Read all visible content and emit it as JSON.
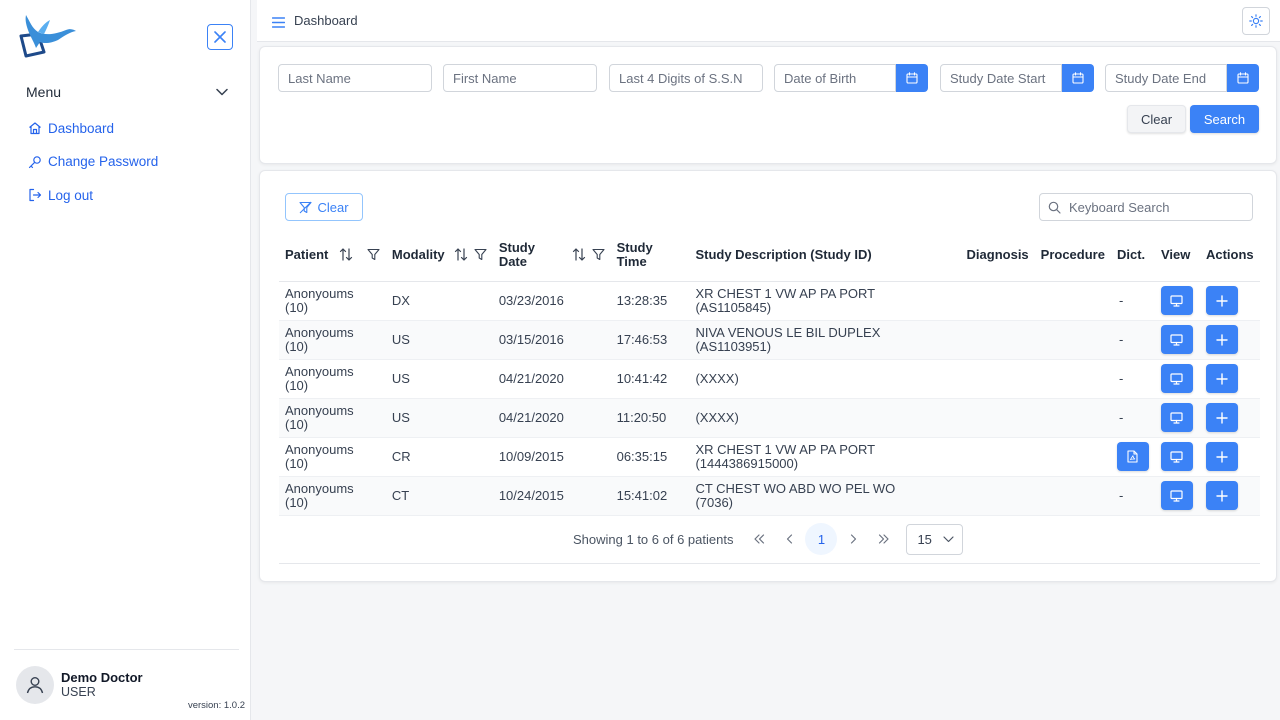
{
  "sidebar": {
    "menu_label": "Menu",
    "items": [
      {
        "label": "Dashboard",
        "icon": "home-icon"
      },
      {
        "label": "Change Password",
        "icon": "key-icon"
      },
      {
        "label": "Log out",
        "icon": "logout-icon"
      }
    ],
    "user": {
      "name": "Demo Doctor",
      "role": "USER"
    },
    "version": "version: 1.0.2"
  },
  "topbar": {
    "title": "Dashboard"
  },
  "search": {
    "last_name_placeholder": "Last Name",
    "first_name_placeholder": "First Name",
    "ssn_placeholder": "Last 4 Digits of S.S.N",
    "dob_placeholder": "Date of Birth",
    "study_start_placeholder": "Study Date Start",
    "study_end_placeholder": "Study Date End",
    "clear_label": "Clear",
    "search_label": "Search"
  },
  "results": {
    "filter_clear_label": "Clear",
    "keyboard_search_placeholder": "Keyboard Search",
    "columns": {
      "patient": "Patient",
      "modality": "Modality",
      "study_date": "Study Date",
      "study_time": "Study Time",
      "description": "Study Description (Study ID)",
      "diagnosis": "Diagnosis",
      "procedure": "Procedure",
      "dict": "Dict.",
      "view": "View",
      "actions": "Actions"
    },
    "rows": [
      {
        "patient": "Anonyoums (10)",
        "modality": "DX",
        "date": "03/23/2016",
        "time": "13:28:35",
        "description": "XR CHEST 1 VW AP PA PORT (AS1105845)",
        "dict": "-"
      },
      {
        "patient": "Anonyoums (10)",
        "modality": "US",
        "date": "03/15/2016",
        "time": "17:46:53",
        "description": "NIVA VENOUS LE BIL DUPLEX (AS1103951)",
        "dict": "-"
      },
      {
        "patient": "Anonyoums (10)",
        "modality": "US",
        "date": "04/21/2020",
        "time": "10:41:42",
        "description": "(XXXX)",
        "dict": "-"
      },
      {
        "patient": "Anonyoums (10)",
        "modality": "US",
        "date": "04/21/2020",
        "time": "11:20:50",
        "description": "(XXXX)",
        "dict": "-"
      },
      {
        "patient": "Anonyoums (10)",
        "modality": "CR",
        "date": "10/09/2015",
        "time": "06:35:15",
        "description": "XR CHEST 1 VW AP PA PORT (1444386915000)",
        "dict": "pdf"
      },
      {
        "patient": "Anonyoums (10)",
        "modality": "CT",
        "date": "10/24/2015",
        "time": "15:41:02",
        "description": "CT CHEST WO ABD WO PEL WO (7036)",
        "dict": "-"
      }
    ],
    "pagination": {
      "summary": "Showing 1 to 6 of 6 patients",
      "current_page": "1",
      "rows_per_page": "15"
    }
  },
  "colors": {
    "accent": "#3b82f6",
    "link": "#2563eb"
  }
}
